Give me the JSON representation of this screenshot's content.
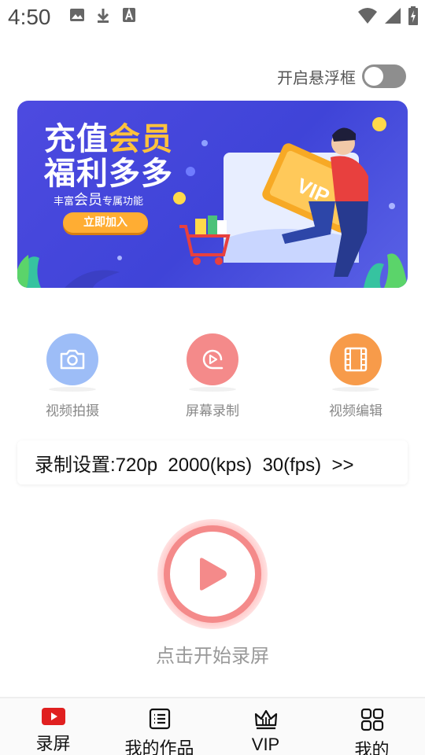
{
  "statusbar": {
    "time": "4:50",
    "icons": [
      "image-icon",
      "download-icon",
      "text-a-icon",
      "wifi-icon",
      "signal-icon",
      "battery-charging-icon"
    ]
  },
  "floating": {
    "label": "开启悬浮框",
    "enabled": false
  },
  "banner": {
    "title_line1_a": "充值",
    "title_line1_b": "会员",
    "title_line2": "福利多多",
    "subtitle_a": "丰富",
    "subtitle_b": "会员",
    "subtitle_c": "专属功能",
    "button": "立即加入",
    "card_text": "VIP"
  },
  "features": [
    {
      "label": "视频拍摄",
      "icon": "camera-icon",
      "color": "#9dbdf7"
    },
    {
      "label": "屏幕录制",
      "icon": "screen-record-icon",
      "color": "#f48a8a"
    },
    {
      "label": "视频编辑",
      "icon": "film-icon",
      "color": "#f79b4a"
    }
  ],
  "settings": {
    "text": "录制设置:720p  2000(kps)  30(fps)  >>"
  },
  "record": {
    "hint": "点击开始录屏",
    "color": "#f48a8a"
  },
  "nav": [
    {
      "label": "录屏",
      "icon": "youtube-play-icon",
      "active": true
    },
    {
      "label": "我的作品",
      "icon": "list-icon",
      "active": false
    },
    {
      "label": "VIP",
      "icon": "crown-icon",
      "active": false
    },
    {
      "label": "我的",
      "icon": "grid-icon",
      "active": false
    }
  ],
  "colors": {
    "accent": "#f48a8a",
    "banner_bg": "#4d4ae0",
    "banner_accent": "#ffc23c",
    "nav_active": "#e02020"
  }
}
